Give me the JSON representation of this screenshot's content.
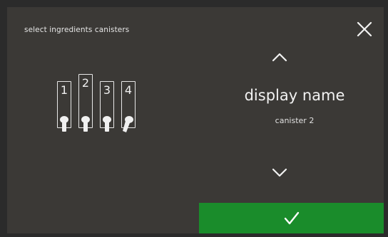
{
  "screen": {
    "title": "select ingredients canisters",
    "close_icon": "close-icon"
  },
  "canisters": [
    {
      "number": "1",
      "selected": false
    },
    {
      "number": "2",
      "selected": true
    },
    {
      "number": "3",
      "selected": false
    },
    {
      "number": "4",
      "selected": false
    }
  ],
  "selection": {
    "display_name": "display name",
    "canister_label": "canister 2",
    "up_icon": "chevron-up-icon",
    "down_icon": "chevron-down-icon"
  },
  "confirm": {
    "icon": "checkmark-icon",
    "color": "#1a8c2b"
  }
}
